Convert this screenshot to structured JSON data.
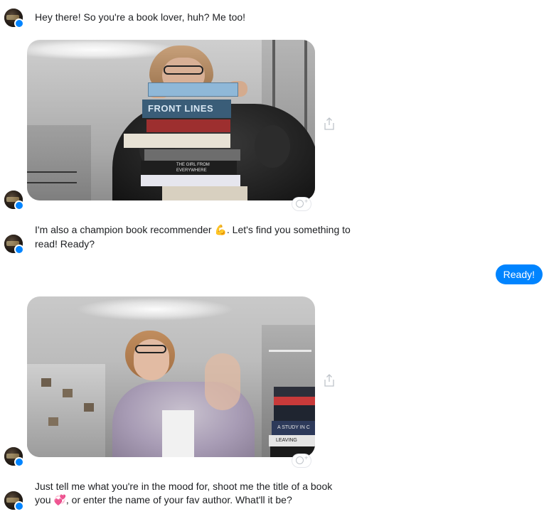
{
  "messages": {
    "m1": {
      "text": "Hey there! So you're a book lover, huh?  Me too!"
    },
    "m2_part1": {
      "text": "I'm also a champion book recommender "
    },
    "m2_emoji": {
      "glyph": "💪"
    },
    "m2_part2": {
      "text": ". Let's find you something to read! Ready?"
    },
    "reply": {
      "text": "Ready!"
    },
    "m3_part1": {
      "text": "Just tell me what you're in the mood for, shoot me the title of a book you "
    },
    "m3_emoji": {
      "glyph": "💞"
    },
    "m3_part2": {
      "text": ", or enter the name of your fav author. What'll it be?"
    }
  },
  "gif1": {
    "book_titles": [
      "FRONT LINES",
      "THE GIRL FROM EVERYWHERE"
    ]
  },
  "gif2": {
    "book_titles": [
      "A STUDY IN C",
      "LEAVING"
    ]
  },
  "colors": {
    "outgoing_bubble": "#0084ff",
    "outgoing_text": "#ffffff",
    "incoming_text": "#1c1e21",
    "badge": "#0084ff"
  },
  "icons": {
    "share": "share-icon",
    "react": "add-reaction-icon",
    "badge": "messenger-badge-icon"
  }
}
